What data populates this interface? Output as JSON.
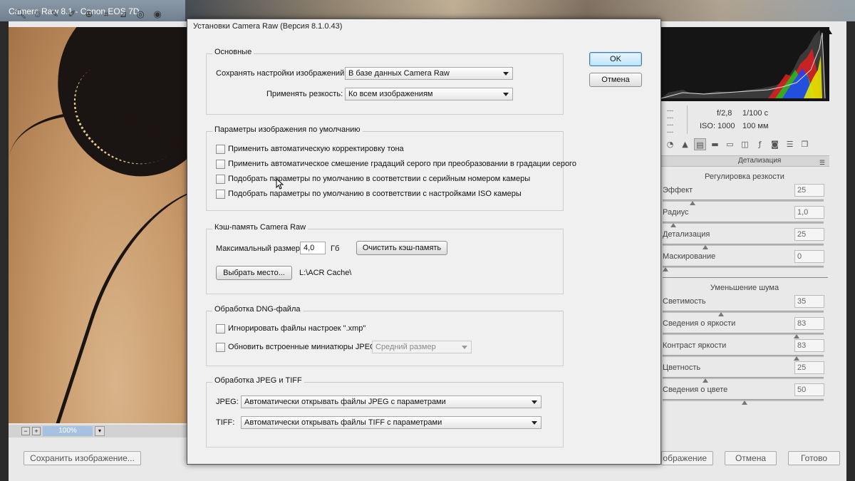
{
  "app": {
    "title": "Camera Raw 8.1  -  Canon EOS 7D",
    "zoom": "100%",
    "save_button": "Сохранить изображение...",
    "open_button_partial": "ображение",
    "cancel_button": "Отмена",
    "done_button": "Готово"
  },
  "meta": {
    "aperture": "f/2,8",
    "shutter": "1/100 с",
    "iso": "ISO: 1000",
    "lens": "100 мм",
    "dashes": "---"
  },
  "panel": {
    "header": "Детализация",
    "sharpening_title": "Регулировка резкости",
    "noise_title": "Уменьшение шума",
    "sharpening": [
      {
        "label": "Эффект",
        "value": "25",
        "fraction": 0.17
      },
      {
        "label": "Радиус",
        "value": "1,0",
        "fraction": 0.05
      },
      {
        "label": "Детализация",
        "value": "25",
        "fraction": 0.25
      },
      {
        "label": "Маскирование",
        "value": "0",
        "fraction": 0.0
      }
    ],
    "noise": [
      {
        "label": "Светимость",
        "value": "35",
        "fraction": 0.35
      },
      {
        "label": "Сведения о яркости",
        "value": "83",
        "fraction": 0.83
      },
      {
        "label": "Контраст яркости",
        "value": "83",
        "fraction": 0.83
      },
      {
        "label": "Цветность",
        "value": "25",
        "fraction": 0.25
      },
      {
        "label": "Сведения о цвете",
        "value": "50",
        "fraction": 0.5
      }
    ]
  },
  "dialog": {
    "title": "Установки Camera Raw  (Версия 8.1.0.43)",
    "ok": "OK",
    "cancel": "Отмена",
    "general": {
      "title": "Основные",
      "save_label": "Сохранять настройки изображений:",
      "save_value": "В базе данных Camera Raw",
      "sharpen_label": "Применять резкость:",
      "sharpen_value": "Ко всем изображениям"
    },
    "defaults": {
      "title": "Параметры изображения по умолчанию",
      "options": [
        "Применить автоматическую корректировку тона",
        "Применить автоматическое смешение градаций серого при преобразовании в градации серого",
        "Подобрать параметры по умолчанию в соответствии с серийным номером камеры",
        "Подобрать параметры по умолчанию в соответствии с настройками ISO камеры"
      ]
    },
    "cache": {
      "title": "Кэш-память Camera Raw",
      "max_label": "Максимальный размер:",
      "max_value": "4,0",
      "unit": "Гб",
      "purge": "Очистить кэш-память",
      "choose": "Выбрать место...",
      "path": "L:\\ACR Cache\\"
    },
    "dng": {
      "title": "Обработка DNG-файла",
      "ignore": "Игнорировать файлы настроек \".xmp\"",
      "update": "Обновить встроенные миниатюры JPEG:",
      "size": "Средний размер"
    },
    "jpeg_tiff": {
      "title": "Обработка JPEG и TIFF",
      "jpeg_label": "JPEG:",
      "jpeg_value": "Автоматически открывать файлы JPEG с параметрами",
      "tiff_label": "TIFF:",
      "tiff_value": "Автоматически открывать файлы TIFF с параметрами"
    }
  }
}
